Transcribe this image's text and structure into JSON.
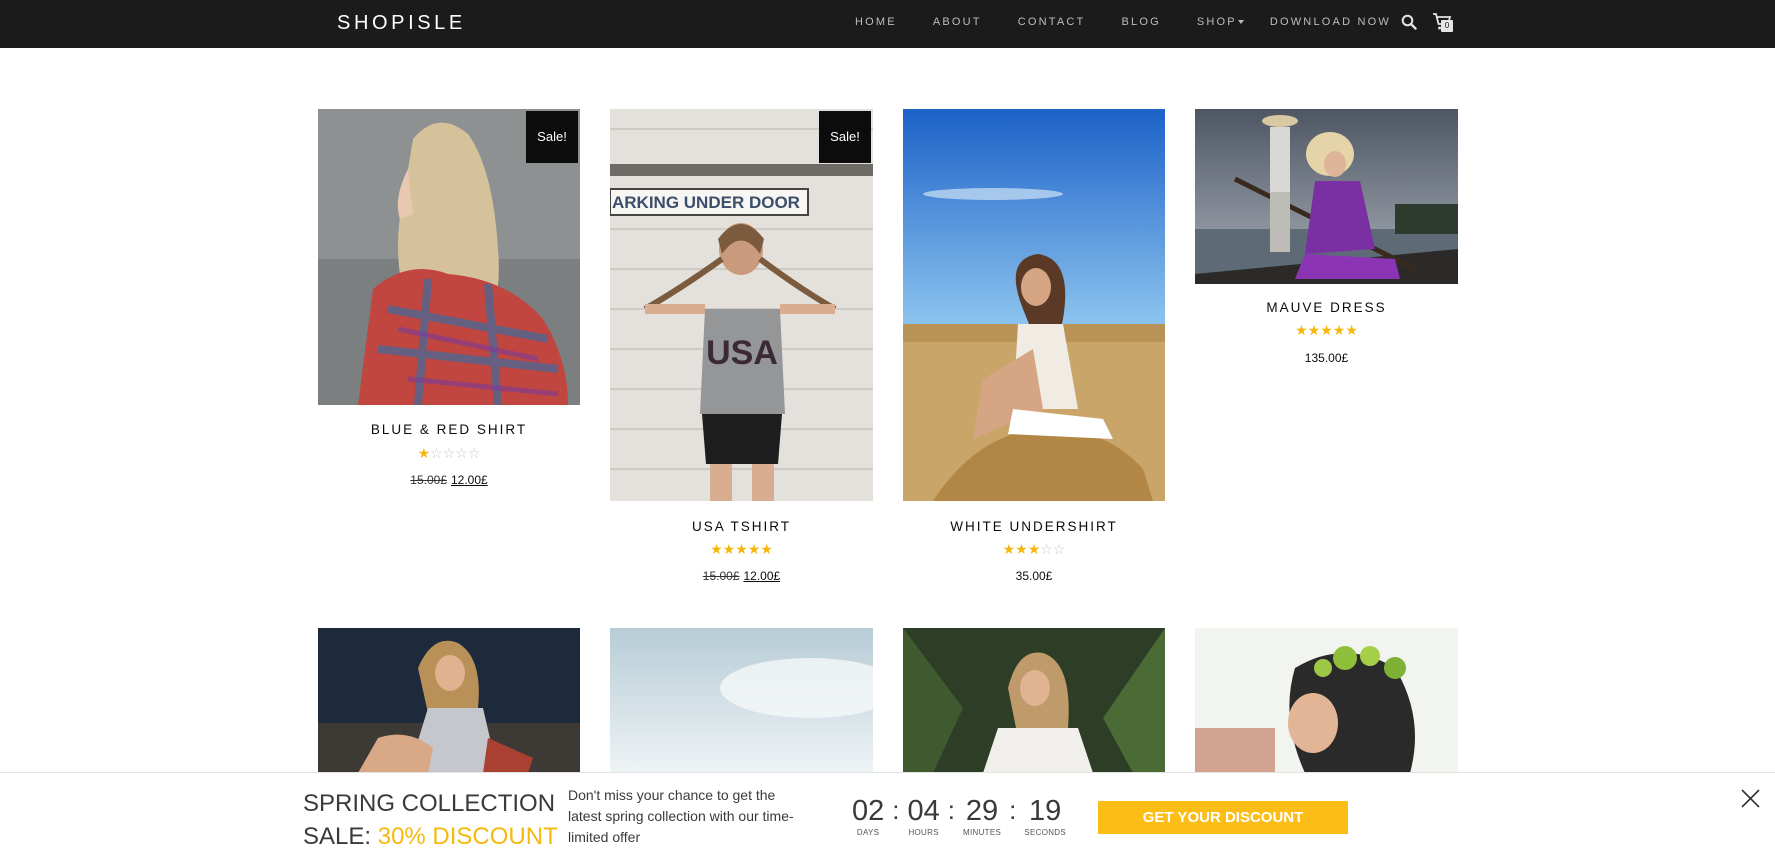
{
  "brand": "SHOPISLE",
  "nav": {
    "items": [
      "HOME",
      "ABOUT",
      "CONTACT",
      "BLOG",
      "SHOP"
    ],
    "download": "DOWNLOAD NOW",
    "cart_count": "0",
    "search_icon": "search-icon",
    "cart_icon": "cart-icon"
  },
  "products": [
    {
      "title": "BLUE & RED SHIRT",
      "badge": "Sale!",
      "rating": 1,
      "old_price": "15.00£",
      "price": "12.00£"
    },
    {
      "title": "USA TSHIRT",
      "badge": "Sale!",
      "rating": 5,
      "old_price": "15.00£",
      "price": "12.00£"
    },
    {
      "title": "WHITE UNDERSHIRT",
      "rating": 3,
      "price": "35.00£"
    },
    {
      "title": "MAUVE DRESS",
      "rating": 5,
      "price": "135.00£"
    }
  ],
  "photo_text": {
    "sign": "ARKING UNDER DOOR",
    "shirt": "USA"
  },
  "banner": {
    "title_line1": "SPRING COLLECTION",
    "title_line2_prefix": "SALE: ",
    "title_line2_accent": "30% DISCOUNT",
    "text": "Don't miss your chance to get the latest spring collection with our time-limited offer",
    "countdown": [
      {
        "value": "02",
        "label": "DAYS"
      },
      {
        "value": "04",
        "label": "HOURS"
      },
      {
        "value": "29",
        "label": "MINUTES"
      },
      {
        "value": "19",
        "label": "SECONDS"
      }
    ],
    "button": "GET YOUR DISCOUNT",
    "close_icon": "close-icon"
  },
  "colors": {
    "navbar": "#1b1b1b",
    "star": "#f5b70a",
    "accent": "#f5b90e",
    "button": "#fdbd17",
    "badge": "#0c0c0c"
  }
}
